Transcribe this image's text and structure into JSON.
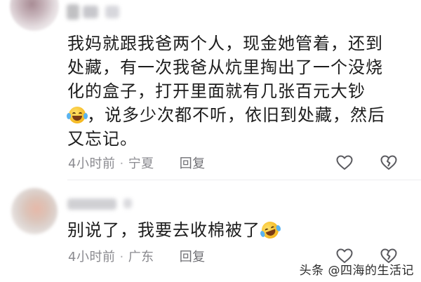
{
  "comments": [
    {
      "text_line1": "我妈就跟我爸两个人，现金她管着，还到",
      "text_line2": "处藏，有一次我爸从炕里掏出了一个没烧",
      "text_line3": "化的盒子，打开里面就有几张百元大钞",
      "text_line4_after_emoji": "，说多少次都不听，依旧到处藏，然后",
      "text_line5": "又忘记。",
      "emoji": "laughing-crying-emoji",
      "time": "4小时前",
      "separator": "·",
      "location": "宁夏",
      "reply_label": "回复"
    },
    {
      "text": "别说了，我要去收棉被了",
      "emoji": "rofl-emoji",
      "time": "4小时前",
      "separator": "·",
      "location": "广东",
      "reply_label": "回复"
    }
  ],
  "watermark": "头条 @四海的生活记"
}
